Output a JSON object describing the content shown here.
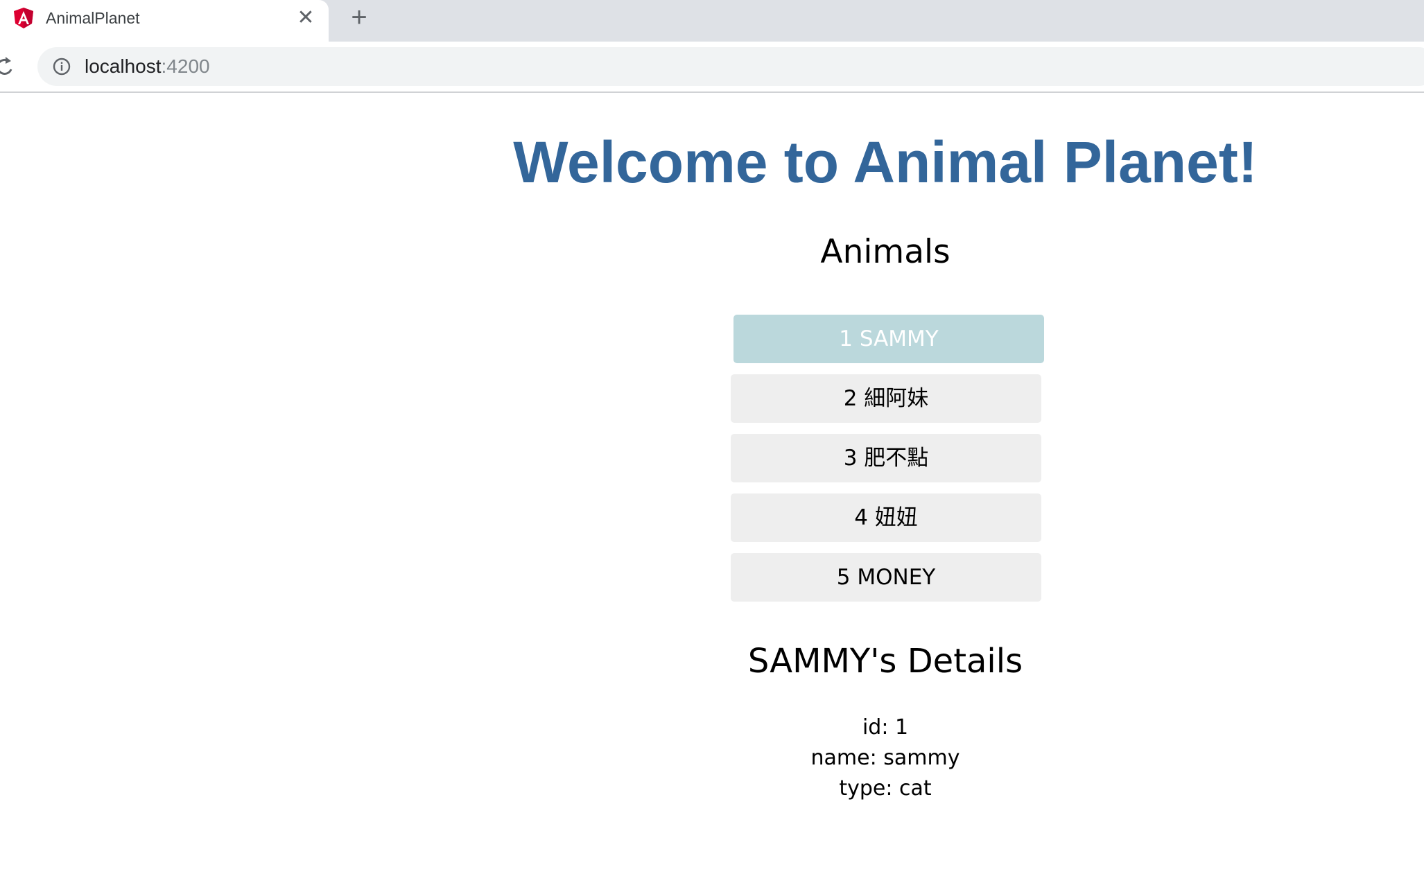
{
  "browser": {
    "tab_title": "AnimalPlanet",
    "url_host": "localhost",
    "url_port": ":4200"
  },
  "page": {
    "title": "Welcome to Animal Planet!",
    "animals_heading": "Animals",
    "animals": [
      {
        "id": "1",
        "name": "SAMMY",
        "selected": true
      },
      {
        "id": "2",
        "name": "細阿妹",
        "selected": false
      },
      {
        "id": "3",
        "name": "肥不點",
        "selected": false
      },
      {
        "id": "4",
        "name": "妞妞",
        "selected": false
      },
      {
        "id": "5",
        "name": "MONEY",
        "selected": false
      }
    ],
    "details": {
      "heading": "SAMMY's Details",
      "id_line": "id: 1",
      "name_line": "name: sammy",
      "type_line": "type: cat"
    }
  },
  "colors": {
    "title": "#33669a",
    "selected_item_bg": "#bbd8dc",
    "item_bg": "#eeeeee",
    "angular_logo": "#dd0031"
  },
  "icons": {
    "favicon": "angular-logo-icon",
    "close": "close-icon",
    "new_tab": "plus-icon",
    "reload": "reload-icon",
    "site_info": "info-icon"
  }
}
